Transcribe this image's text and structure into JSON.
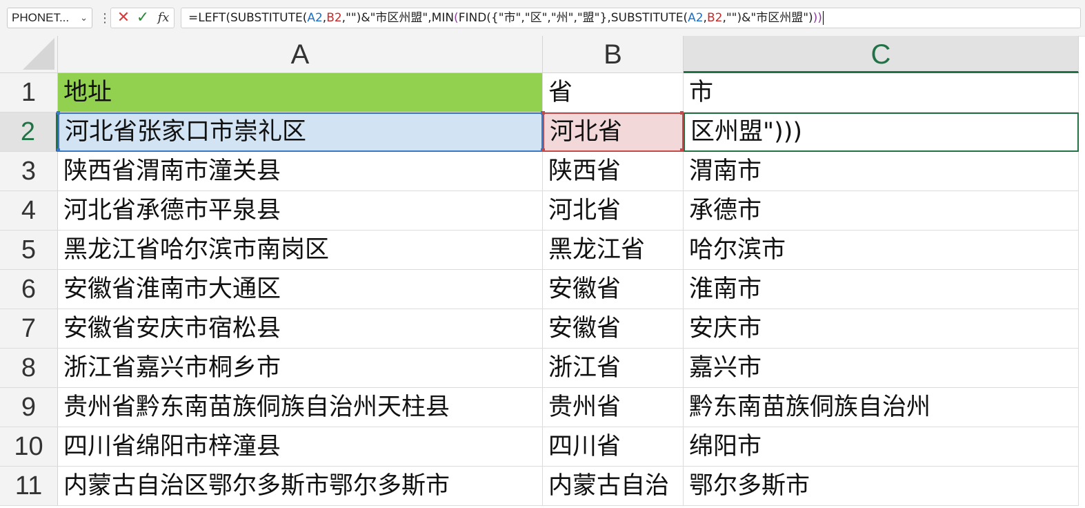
{
  "formula_bar": {
    "name_box": "PHONET...",
    "formula_segments": [
      {
        "text": "=LEFT(SUBSTITUTE(",
        "style": "plain"
      },
      {
        "text": "A2",
        "style": "blue"
      },
      {
        "text": ",",
        "style": "plain"
      },
      {
        "text": "B2",
        "style": "red"
      },
      {
        "text": ",\"\")&\"市区州盟\",MIN",
        "style": "plain"
      },
      {
        "text": "(",
        "style": "purple"
      },
      {
        "text": "FIND({\"市\",\"区\",\"州\",\"盟\"},SUBSTITUTE(",
        "style": "plain"
      },
      {
        "text": "A2",
        "style": "blue"
      },
      {
        "text": ",",
        "style": "plain"
      },
      {
        "text": "B2",
        "style": "red"
      },
      {
        "text": ",\"\")&\"市区州盟\")",
        "style": "plain"
      },
      {
        "text": "))",
        "style": "purple"
      }
    ]
  },
  "columns": [
    "A",
    "B",
    "C"
  ],
  "active_column": "C",
  "active_row": "2",
  "rows": [
    {
      "num": "1",
      "a": "地址",
      "b": "省",
      "c": "市"
    },
    {
      "num": "2",
      "a": "河北省张家口市崇礼区",
      "b": "河北省",
      "c": "区州盟\")))"
    },
    {
      "num": "3",
      "a": "陕西省渭南市潼关县",
      "b": "陕西省",
      "c": "渭南市"
    },
    {
      "num": "4",
      "a": "河北省承德市平泉县",
      "b": "河北省",
      "c": "承德市"
    },
    {
      "num": "5",
      "a": "黑龙江省哈尔滨市南岗区",
      "b": "黑龙江省",
      "c": "哈尔滨市"
    },
    {
      "num": "6",
      "a": "安徽省淮南市大通区",
      "b": "安徽省",
      "c": "淮南市"
    },
    {
      "num": "7",
      "a": "安徽省安庆市宿松县",
      "b": "安徽省",
      "c": "安庆市"
    },
    {
      "num": "8",
      "a": "浙江省嘉兴市桐乡市",
      "b": "浙江省",
      "c": "嘉兴市"
    },
    {
      "num": "9",
      "a": "贵州省黔东南苗族侗族自治州天柱县",
      "b": "贵州省",
      "c": "黔东南苗族侗族自治州"
    },
    {
      "num": "10",
      "a": "四川省绵阳市梓潼县",
      "b": "四川省",
      "c": "绵阳市"
    },
    {
      "num": "11",
      "a": "内蒙古自治区鄂尔多斯市鄂尔多斯市",
      "b": "内蒙古自治",
      "c": "鄂尔多斯市"
    }
  ],
  "colors": {
    "header_fill": "#92d050",
    "ref_a2": "#1b6fc4",
    "ref_b2": "#c62b2b",
    "active": "#217346"
  }
}
